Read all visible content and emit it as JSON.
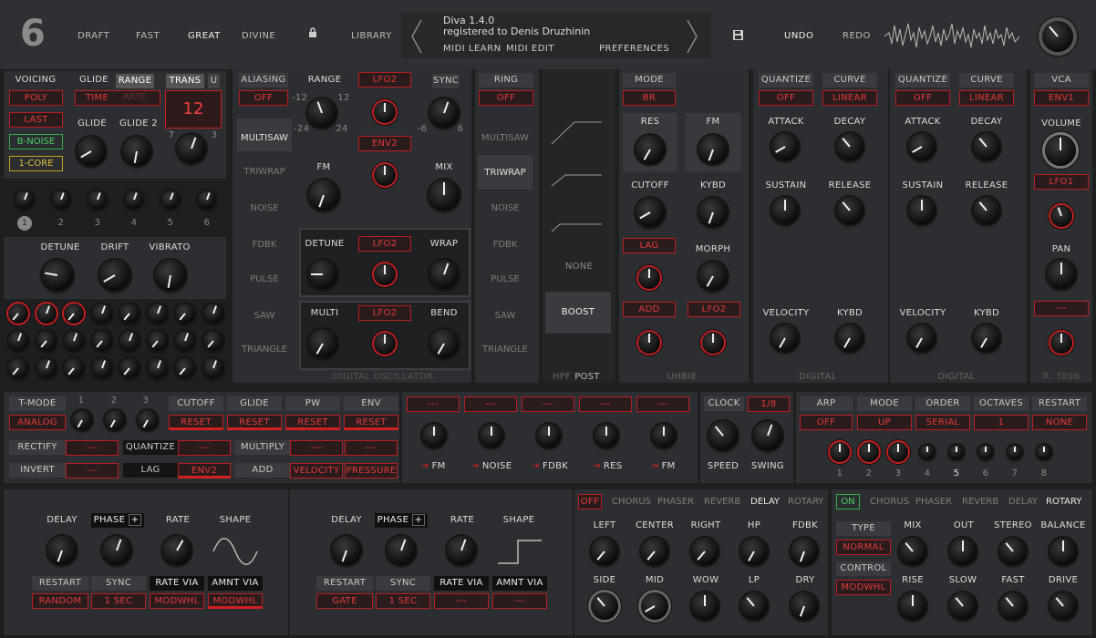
{
  "topbar": {
    "logo": "6",
    "draft": "DRAFT",
    "fast": "FAST",
    "great": "GREAT",
    "divine": "DIVINE",
    "library": "LIBRARY",
    "title": "Diva 1.4.0",
    "registered": "registered to Denis Druzhinin",
    "midi_learn": "MIDI LEARN",
    "midi_edit": "MIDI EDIT",
    "preferences": "PREFERENCES",
    "undo": "UNDO",
    "redo": "REDO"
  },
  "voicing": {
    "header": "VOICING",
    "poly": "POLY",
    "last": "LAST",
    "bnoise": "B-NOISE",
    "core": "1-CORE",
    "glide_h": "GLIDE",
    "range_h": "RANGE",
    "trans_h": "TRANS",
    "u": "U",
    "time": "TIME",
    "rate": "RATE",
    "glide": "GLIDE",
    "glide2": "GLIDE 2",
    "trans_val": "12",
    "r1": "7",
    "r2": "3",
    "voices": [
      "1",
      "2",
      "3",
      "4",
      "5",
      "6"
    ],
    "detune": "DETUNE",
    "drift": "DRIFT",
    "vibrato": "VIBRATO"
  },
  "osc1": {
    "aliasing": "ALIASING",
    "aliasing_val": "OFF",
    "range": "RANGE",
    "lfo2a": "LFO2",
    "sync": "SYNC",
    "t12l": "-12",
    "t12r": "12",
    "t24l": "-24",
    "t24r": "24",
    "t6l": "-6",
    "t6r": "6",
    "env2": "ENV2",
    "fm": "FM",
    "mix": "MIX",
    "multisaw": "MULTISAW",
    "triwrap": "TRIWRAP",
    "noise": "NOISE",
    "fdbk": "FDBK",
    "pulse": "PULSE",
    "saw": "SAW",
    "triangle": "TRIANGLE",
    "detune": "DETUNE",
    "lfo2b": "LFO2",
    "wrap": "WRAP",
    "multi": "MULTI",
    "lfo2c": "LFO2",
    "bend": "BEND",
    "footer": "DIGITAL OSCILLATOR"
  },
  "osc2": {
    "ring": "RING",
    "ring_val": "OFF",
    "multisaw": "MULTISAW",
    "triwrap": "TRIWRAP",
    "noise": "NOISE",
    "fdbk": "FDBK",
    "pulse": "PULSE",
    "saw": "SAW",
    "triangle": "TRIANGLE"
  },
  "hpf": {
    "none": "NONE",
    "boost": "BOOST",
    "footer1": "HPF",
    "footer2": "POST"
  },
  "filter": {
    "mode": "MODE",
    "mode_val": "BR",
    "res": "RES",
    "fm": "FM",
    "cutoff": "CUTOFF",
    "kybd": "KYBD",
    "lag": "LAG",
    "morph": "MORPH",
    "add": "ADD",
    "lfo2": "LFO2",
    "footer": "UHBIE"
  },
  "env1": {
    "quantize": "QUANTIZE",
    "q_val": "OFF",
    "curve": "CURVE",
    "curve_val": "LINEAR",
    "attack": "ATTACK",
    "decay": "DECAY",
    "sustain": "SUSTAIN",
    "release": "RELEASE",
    "velocity": "VELOCITY",
    "kybd": "KYBD",
    "footer": "DIGITAL"
  },
  "env2": {
    "quantize": "QUANTIZE",
    "q_val": "OFF",
    "curve": "CURVE",
    "curve_val": "LINEAR",
    "attack": "ATTACK",
    "decay": "DECAY",
    "sustain": "SUSTAIN",
    "release": "RELEASE",
    "velocity": "VELOCITY",
    "kybd": "KYBD",
    "footer": "DIGITAL"
  },
  "vca": {
    "header": "VCA",
    "env": "ENV1",
    "volume": "VOLUME",
    "lfo1": "LFO1",
    "pan": "PAN",
    "dash": "---",
    "rev": "R: 3898"
  },
  "mod": {
    "tmode": "T-MODE",
    "analog": "ANALOG",
    "n1": "1",
    "n2": "2",
    "n3": "3",
    "cutoff": "CUTOFF",
    "glide": "GLIDE",
    "pw": "PW",
    "env": "ENV",
    "reset": "RESET",
    "rectify": "RECTIFY",
    "quantize": "QUANTIZE",
    "multiply": "MULTIPLY",
    "invert": "INVERT",
    "lag": "LAG",
    "env2": "ENV2",
    "add": "ADD",
    "velocity": "VELOCITY",
    "pressure": "PRESSURE",
    "dash": "---"
  },
  "mixer": {
    "dash": "---",
    "fm": "FM",
    "noise": "NOISE",
    "fdbk": "FDBK",
    "res": "RES",
    "fm2": "FM"
  },
  "clock": {
    "clock": "CLOCK",
    "val": "1/8",
    "speed": "SPEED",
    "swing": "SWING"
  },
  "arp": {
    "arp": "ARP",
    "arp_val": "OFF",
    "mode": "MODE",
    "mode_val": "UP",
    "order": "ORDER",
    "order_val": "SERIAL",
    "octaves": "OCTAVES",
    "oct_val": "1",
    "restart": "RESTART",
    "restart_val": "NONE",
    "steps": [
      "1",
      "2",
      "3",
      "4",
      "5",
      "6",
      "7",
      "8"
    ]
  },
  "lfo1": {
    "delay": "DELAY",
    "phase": "PHASE",
    "plus": "+",
    "rate": "RATE",
    "shape": "SHAPE",
    "restart": "RESTART",
    "sync": "SYNC",
    "rate_via": "RATE VIA",
    "amnt_via": "AMNT VIA",
    "restart_val": "RANDOM",
    "sync_val": "1 SEC",
    "rate_via_val": "MODWHL",
    "amnt_via_val": "MODWHL"
  },
  "lfo2": {
    "delay": "DELAY",
    "phase": "PHASE",
    "plus": "+",
    "rate": "RATE",
    "shape": "SHAPE",
    "restart": "RESTART",
    "sync": "SYNC",
    "rate_via": "RATE VIA",
    "amnt_via": "AMNT VIA",
    "restart_val": "GATE",
    "sync_val": "1 SEC",
    "rate_via_val": "---",
    "amnt_via_val": "---"
  },
  "fx1": {
    "off": "OFF",
    "chorus": "CHORUS",
    "phaser": "PHASER",
    "reverb": "REVERB",
    "delay": "DELAY",
    "rotary": "ROTARY",
    "left": "LEFT",
    "center": "CENTER",
    "right": "RIGHT",
    "hp": "HP",
    "fdbk": "FDBK",
    "side": "SIDE",
    "mid": "MID",
    "wow": "WOW",
    "lp": "LP",
    "dry": "DRY"
  },
  "fx2": {
    "on": "ON",
    "chorus": "CHORUS",
    "phaser": "PHASER",
    "reverb": "REVERB",
    "delay": "DELAY",
    "rotary": "ROTARY",
    "type": "TYPE",
    "type_val": "NORMAL",
    "control": "CONTROL",
    "control_val": "MODWHL",
    "mix": "MIX",
    "out": "OUT",
    "stereo": "STEREO",
    "balance": "BALANCE",
    "rise": "RISE",
    "slow": "SLOW",
    "fast": "FAST",
    "drive": "DRIVE"
  }
}
